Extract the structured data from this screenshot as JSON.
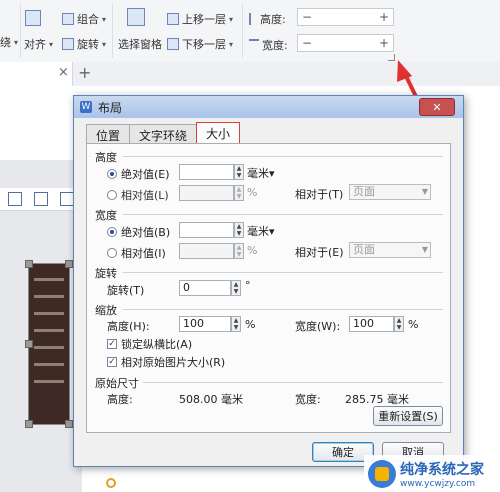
{
  "ribbon": {
    "group_label": "组合",
    "align_label": "对齐",
    "rotate_label": "旋转",
    "selection_pane_label": "选择窗格",
    "bring_forward_label": "上移一层",
    "send_backward_label": "下移一层",
    "height_label": "高度:",
    "width_label": "宽度:",
    "partial_left": "绕",
    "minus": "−",
    "plus": "+"
  },
  "tabbar": {
    "close": "×",
    "add": "+"
  },
  "dialog": {
    "title": "布局",
    "close_symbol": "✕",
    "tabs": [
      "位置",
      "文字环绕",
      "大小"
    ],
    "active_tab": "大小",
    "height_section": {
      "title": "高度",
      "absolute_label": "绝对值(E)",
      "absolute_unit": "毫米▾",
      "relative_label": "相对值(L)",
      "relative_unit": "%",
      "relative_to_label": "相对于(T)",
      "relative_to_value": "页面"
    },
    "width_section": {
      "title": "宽度",
      "absolute_label": "绝对值(B)",
      "absolute_unit": "毫米▾",
      "relative_label": "相对值(I)",
      "relative_unit": "%",
      "relative_to_label": "相对于(E)",
      "relative_to_value": "页面"
    },
    "rotate_section": {
      "title": "旋转",
      "label": "旋转(T)",
      "value": "0",
      "unit": "°"
    },
    "scale_section": {
      "title": "缩放",
      "height_label": "高度(H):",
      "height_value": "100",
      "height_unit": "%",
      "width_label": "宽度(W):",
      "width_value": "100",
      "width_unit": "%",
      "lock_aspect_label": "锁定纵横比(A)",
      "relative_original_label": "相对原始图片大小(R)"
    },
    "original_section": {
      "title": "原始尺寸",
      "height_label": "高度:",
      "height_value": "508.00 毫米",
      "width_label": "宽度:",
      "width_value": "285.75 毫米",
      "reset_label": "重新设置(S)"
    },
    "ok_label": "确定",
    "cancel_label": "取消"
  },
  "watermark": {
    "name": "纯净系统之家",
    "url": "www.ycwjzy.com"
  },
  "colors": {
    "accent_red": "#d64040",
    "arrow_red": "#e03030"
  }
}
